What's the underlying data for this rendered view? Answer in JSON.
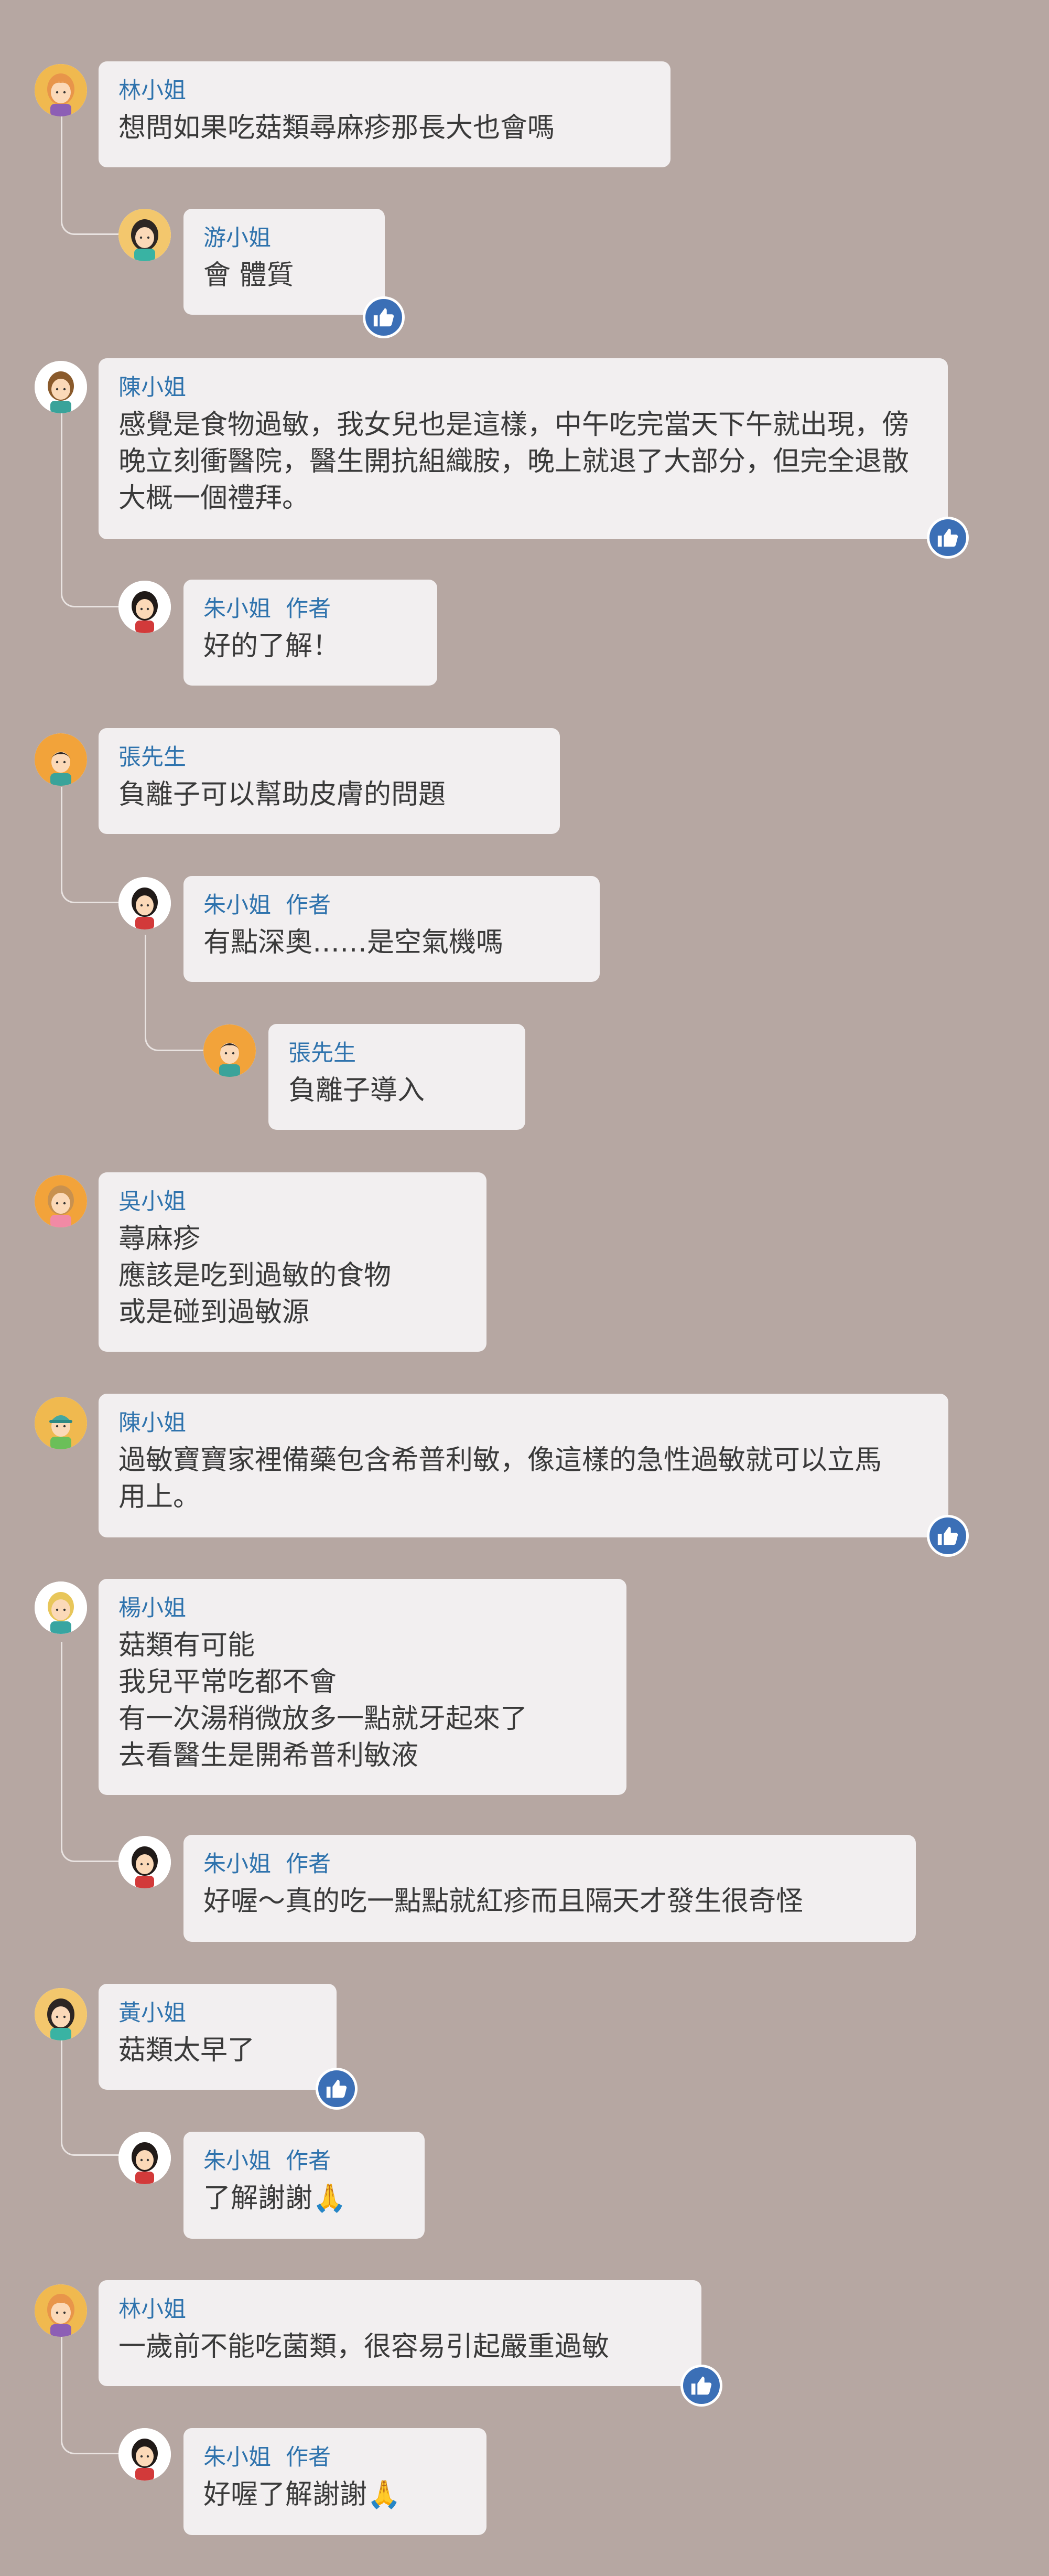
{
  "icons": {
    "like": "thumbs-up-icon",
    "avatar": "user-avatar-icon",
    "pray": "pray-hands-emoji"
  },
  "colors": {
    "background": "#b6a7a2",
    "bubble": "#f2eff0",
    "name": "#2f73ad",
    "text": "#3a3a3a",
    "like": "#3b6fb6"
  },
  "comments": [
    {
      "name": "林小姐",
      "author_tag": "",
      "text": "想問如果吃菇類尋麻疹那長大也會嗎"
    },
    {
      "name": "游小姐",
      "author_tag": "",
      "text": "會 體質"
    },
    {
      "name": "陳小姐",
      "author_tag": "",
      "text": "感覺是食物過敏，我女兒也是這樣，中午吃完當天下午就出現，傍\n晚立刻衝醫院，醫生開抗組織胺，晚上就退了大部分，但完全退散\n大概一個禮拜。"
    },
    {
      "name": "朱小姐",
      "author_tag": "作者",
      "text": "好的了解！"
    },
    {
      "name": "張先生",
      "author_tag": "",
      "text": "負離子可以幫助皮膚的問題"
    },
    {
      "name": "朱小姐",
      "author_tag": "作者",
      "text": "有點深奧……是空氣機嗎"
    },
    {
      "name": "張先生",
      "author_tag": "",
      "text": "負離子導入"
    },
    {
      "name": "吳小姐",
      "author_tag": "",
      "text": "蕁麻疹\n應該是吃到過敏的食物\n或是碰到過敏源"
    },
    {
      "name": "陳小姐",
      "author_tag": "",
      "text": "過敏寶寶家裡備藥包含希普利敏，像這樣的急性過敏就可以立馬\n用上。"
    },
    {
      "name": "楊小姐",
      "author_tag": "",
      "text": "菇類有可能\n我兒平常吃都不會\n有一次湯稍微放多一點就牙起來了\n去看醫生是開希普利敏液"
    },
    {
      "name": "朱小姐",
      "author_tag": "作者",
      "text": "好喔～真的吃一點點就紅疹而且隔天才發生很奇怪"
    },
    {
      "name": "黃小姐",
      "author_tag": "",
      "text": "菇類太早了"
    },
    {
      "name": "朱小姐",
      "author_tag": "作者",
      "text": "了解謝謝🙏"
    },
    {
      "name": "林小姐",
      "author_tag": "",
      "text": "一歲前不能吃菌類，很容易引起嚴重過敏"
    },
    {
      "name": "朱小姐",
      "author_tag": "作者",
      "text": "好喔了解謝謝🙏"
    }
  ]
}
